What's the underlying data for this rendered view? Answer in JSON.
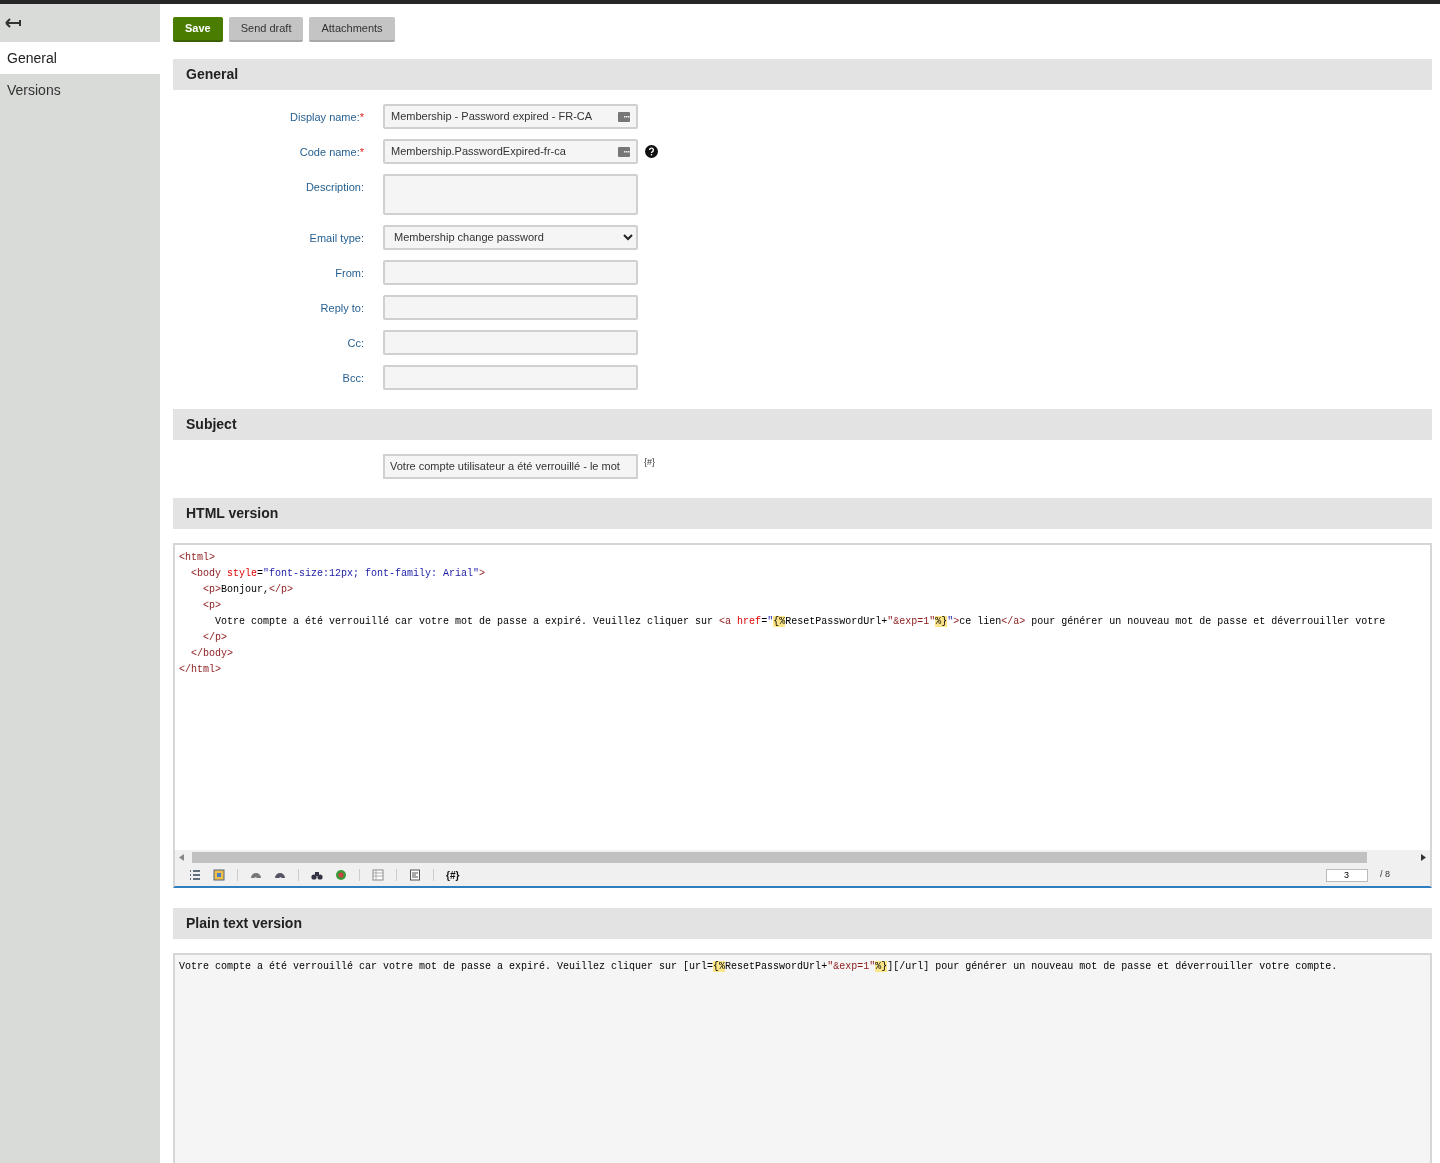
{
  "sidebar": {
    "items": [
      {
        "label": "General",
        "selected": true
      },
      {
        "label": "Versions",
        "selected": false
      }
    ]
  },
  "toolbar": {
    "buttons": [
      {
        "label": "Save",
        "kind": "primary"
      },
      {
        "label": "Send draft",
        "kind": "secondary"
      },
      {
        "label": "Attachments",
        "kind": "secondary"
      }
    ]
  },
  "general": {
    "title": "General",
    "fields": [
      {
        "label": "Display name:",
        "required_mark": "*",
        "kind": "text",
        "value": "Membership - Password expired - FR-CA",
        "has_help": false
      },
      {
        "label": "Code name:",
        "required_mark": "*",
        "kind": "text",
        "value": "Membership.PasswordExpired-fr-ca",
        "has_help": true
      },
      {
        "label": "Description:",
        "kind": "textarea",
        "has_help": false
      },
      {
        "label": "Email type:",
        "kind": "select",
        "value": "Membership change password",
        "has_help": false
      },
      {
        "label": "From:",
        "kind": "empty",
        "has_help": false
      },
      {
        "label": "Reply to:",
        "kind": "empty",
        "has_help": false
      },
      {
        "label": "Cc:",
        "kind": "empty",
        "has_help": false
      },
      {
        "label": "Bcc:",
        "kind": "empty",
        "has_help": false
      }
    ]
  },
  "subject": {
    "title": "Subject",
    "value": "Votre compte utilisateur a été verrouillé - le mot",
    "macro_label": "{#}"
  },
  "html_version": {
    "title": "HTML version",
    "lines": [
      [
        {
          "kind": "tag",
          "text": "<html>"
        }
      ],
      [
        {
          "kind": "tag",
          "text": "  <body"
        },
        {
          "kind": "attr",
          "text": " style"
        },
        {
          "kind": "text",
          "text": "="
        },
        {
          "kind": "string",
          "text": "\"font-size:12px; font-family: Arial\""
        },
        {
          "kind": "tag",
          "text": ">"
        }
      ],
      [
        {
          "kind": "tag",
          "text": "    <p>"
        },
        {
          "kind": "text",
          "text": "Bonjour,"
        },
        {
          "kind": "tag",
          "text": "</p>"
        }
      ],
      [
        {
          "kind": "tag",
          "text": "    <p>"
        }
      ],
      [
        {
          "kind": "text",
          "text": "      Votre compte a été verrouillé car votre mot de passe a expiré. Veuillez cliquer sur "
        },
        {
          "kind": "tag",
          "text": "<a"
        },
        {
          "kind": "attr",
          "text": " href"
        },
        {
          "kind": "text",
          "text": "="
        },
        {
          "kind": "string",
          "text": "\""
        },
        {
          "kind": "macro",
          "text": "{%"
        },
        {
          "kind": "text",
          "text": "ResetPasswordUrl+"
        },
        {
          "kind": "tag",
          "text": "\"&exp=1\""
        },
        {
          "kind": "macro",
          "text": "%}"
        },
        {
          "kind": "string",
          "text": "\""
        },
        {
          "kind": "tag",
          "text": ">"
        },
        {
          "kind": "text",
          "text": "ce lien"
        },
        {
          "kind": "tag",
          "text": "</a>"
        },
        {
          "kind": "text",
          "text": " pour générer un nouveau mot de passe et déverrouiller votre"
        }
      ],
      [
        {
          "kind": "tag",
          "text": "    </p>"
        }
      ],
      [
        {
          "kind": "tag",
          "text": "  </body>"
        }
      ],
      [
        {
          "kind": "tag",
          "text": "</html>"
        }
      ]
    ],
    "macro_label": "{#}",
    "page": "3",
    "page_total": "/ 8"
  },
  "plain_text_version": {
    "title": "Plain text version",
    "lines": [
      [
        {
          "kind": "text",
          "text": "Votre compte a été verrouillé car votre mot de passe a expiré. Veuillez cliquer sur [url="
        },
        {
          "kind": "macro",
          "text": "{%"
        },
        {
          "kind": "text",
          "text": "ResetPasswordUrl+"
        },
        {
          "kind": "tag",
          "text": "\"&exp=1\""
        },
        {
          "kind": "macro",
          "text": "%}"
        },
        {
          "kind": "text",
          "text": "][/url] pour générer un nouveau mot de passe et déverrouiller votre compte."
        }
      ]
    ]
  }
}
